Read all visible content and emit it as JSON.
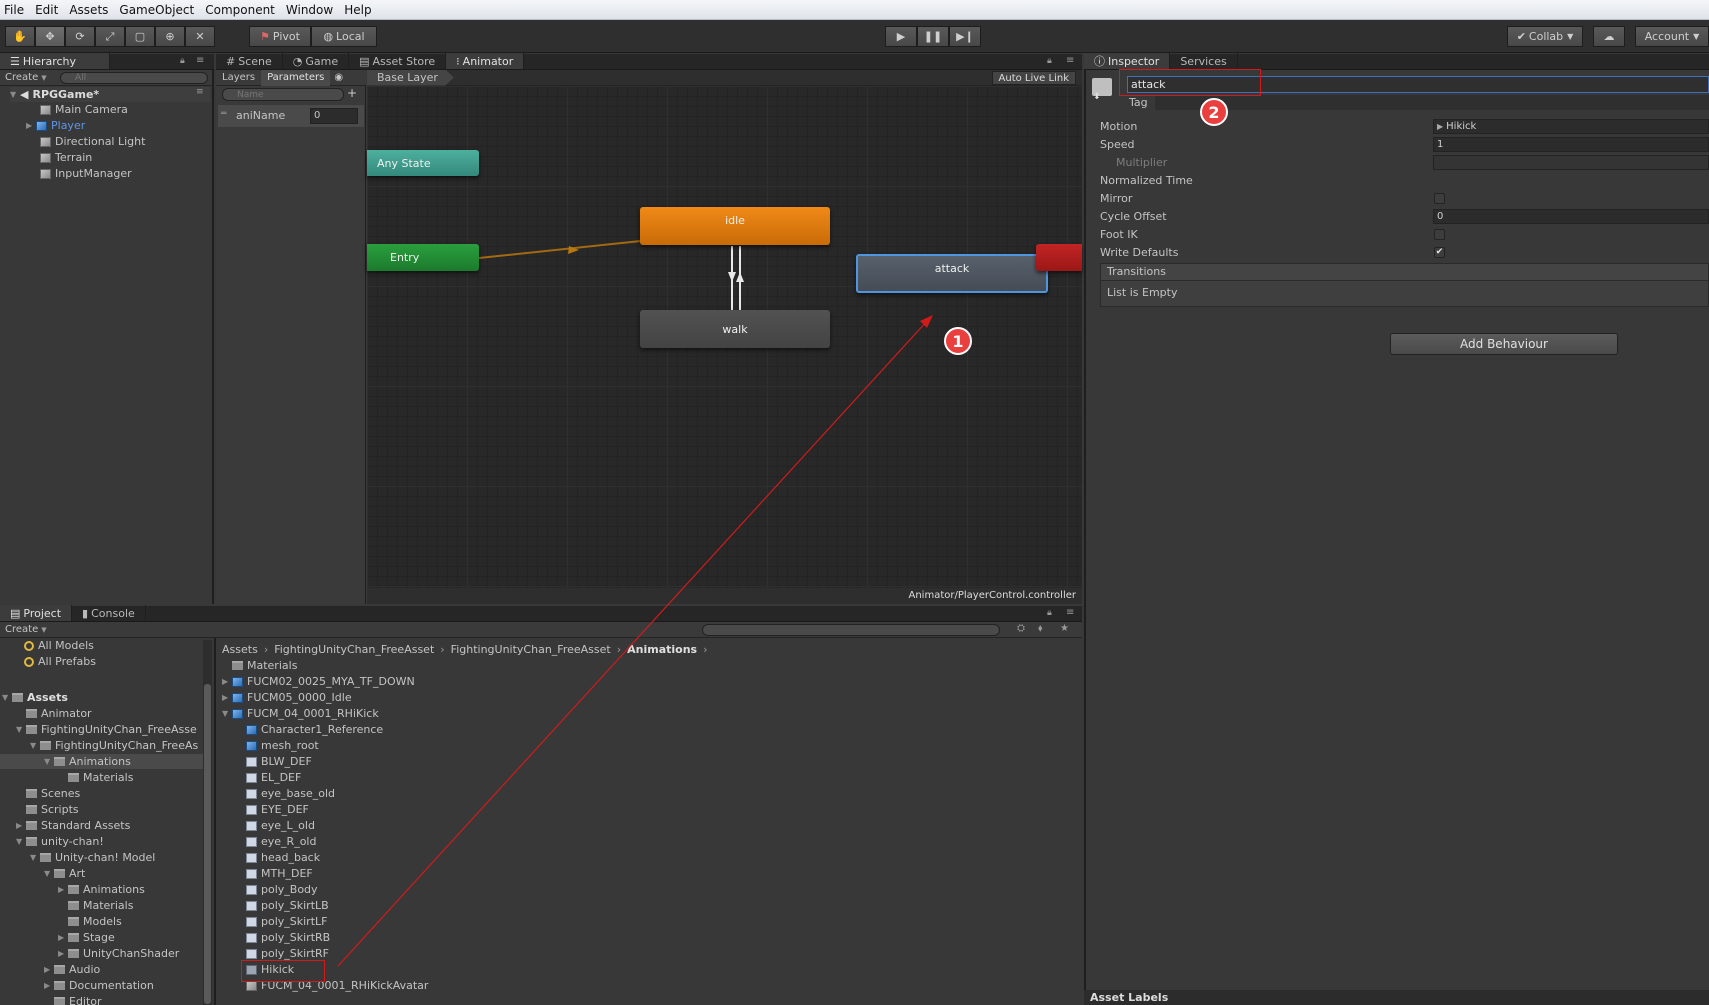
{
  "menubar": {
    "items": [
      "File",
      "Edit",
      "Assets",
      "GameObject",
      "Component",
      "Window",
      "Help"
    ]
  },
  "toolbar": {
    "tool_icons": [
      "hand-icon",
      "move-icon",
      "rotate-icon",
      "scale-icon",
      "rect-icon",
      "transform-icon",
      "custom-icon"
    ],
    "pivot": "Pivot",
    "local": "Local",
    "collab": "Collab",
    "account": "Account"
  },
  "hierarchy": {
    "tab": "Hierarchy",
    "create": "Create",
    "search_placeholder": "All",
    "scene": "RPGGame*",
    "items": [
      "Main Camera",
      "Player",
      "Directional Light",
      "Terrain",
      "InputManager"
    ]
  },
  "center_tabs": [
    "Scene",
    "Game",
    "Asset Store",
    "Animator"
  ],
  "animator": {
    "layers_tab": "Layers",
    "params_tab": "Parameters",
    "name_placeholder": "Name",
    "param_name": "aniName",
    "param_value": "0",
    "breadcrumb": "Base Layer",
    "auto_live_link": "Auto Live Link",
    "footer": "Animator/PlayerControl.controller",
    "states": {
      "any": "Any State",
      "entry": "Entry",
      "idle": "idle",
      "walk": "walk",
      "attack": "attack"
    }
  },
  "inspector": {
    "tabs": [
      "Inspector",
      "Services"
    ],
    "state_name": "attack",
    "tag_label": "Tag",
    "fields": {
      "motion_label": "Motion",
      "motion_value": "Hikick",
      "speed_label": "Speed",
      "speed_value": "1",
      "multiplier_label": "Multiplier",
      "normalized_label": "Normalized Time",
      "mirror_label": "Mirror",
      "cycle_label": "Cycle Offset",
      "cycle_value": "0",
      "footik_label": "Foot IK",
      "write_label": "Write Defaults"
    },
    "transitions": "Transitions",
    "list_empty": "List is Empty",
    "add_behaviour": "Add Behaviour",
    "asset_labels": "Asset Labels"
  },
  "bottom_tabs": [
    "Project",
    "Console"
  ],
  "project": {
    "create": "Create",
    "favorites": [
      "All Models",
      "All Prefabs"
    ],
    "tree": [
      {
        "label": "Assets",
        "depth": 0,
        "arrow": "▼",
        "bold": true
      },
      {
        "label": "Animator",
        "depth": 1,
        "arrow": ""
      },
      {
        "label": "FightingUnityChan_FreeAsse",
        "depth": 1,
        "arrow": "▼"
      },
      {
        "label": "FightingUnityChan_FreeAs",
        "depth": 2,
        "arrow": "▼"
      },
      {
        "label": "Animations",
        "depth": 3,
        "arrow": "▼",
        "selected": true
      },
      {
        "label": "Materials",
        "depth": 4,
        "arrow": ""
      },
      {
        "label": "Scenes",
        "depth": 1,
        "arrow": ""
      },
      {
        "label": "Scripts",
        "depth": 1,
        "arrow": ""
      },
      {
        "label": "Standard Assets",
        "depth": 1,
        "arrow": "▶"
      },
      {
        "label": "unity-chan!",
        "depth": 1,
        "arrow": "▼"
      },
      {
        "label": "Unity-chan! Model",
        "depth": 2,
        "arrow": "▼"
      },
      {
        "label": "Art",
        "depth": 3,
        "arrow": "▼"
      },
      {
        "label": "Animations",
        "depth": 4,
        "arrow": "▶"
      },
      {
        "label": "Materials",
        "depth": 4,
        "arrow": ""
      },
      {
        "label": "Models",
        "depth": 4,
        "arrow": ""
      },
      {
        "label": "Stage",
        "depth": 4,
        "arrow": "▶"
      },
      {
        "label": "UnityChanShader",
        "depth": 4,
        "arrow": "▶"
      },
      {
        "label": "Audio",
        "depth": 3,
        "arrow": "▶"
      },
      {
        "label": "Documentation",
        "depth": 3,
        "arrow": "▶"
      },
      {
        "label": "Editor",
        "depth": 3,
        "arrow": ""
      }
    ],
    "breadcrumb": [
      "Assets",
      "FightingUnityChan_FreeAsset",
      "FightingUnityChan_FreeAsset",
      "Animations"
    ],
    "files": [
      {
        "label": "Materials",
        "depth": 0,
        "arrow": "",
        "icon": "folder"
      },
      {
        "label": "FUCM02_0025_MYA_TF_DOWN",
        "depth": 0,
        "arrow": "▶",
        "icon": "blue"
      },
      {
        "label": "FUCM05_0000_Idle",
        "depth": 0,
        "arrow": "▶",
        "icon": "blue"
      },
      {
        "label": "FUCM_04_0001_RHiKick",
        "depth": 0,
        "arrow": "▼",
        "icon": "blue"
      },
      {
        "label": "Character1_Reference",
        "depth": 1,
        "arrow": "",
        "icon": "blue"
      },
      {
        "label": "mesh_root",
        "depth": 1,
        "arrow": "",
        "icon": "blue"
      },
      {
        "label": "BLW_DEF",
        "depth": 1,
        "arrow": "",
        "icon": "file"
      },
      {
        "label": "EL_DEF",
        "depth": 1,
        "arrow": "",
        "icon": "file"
      },
      {
        "label": "eye_base_old",
        "depth": 1,
        "arrow": "",
        "icon": "file"
      },
      {
        "label": "EYE_DEF",
        "depth": 1,
        "arrow": "",
        "icon": "file"
      },
      {
        "label": "eye_L_old",
        "depth": 1,
        "arrow": "",
        "icon": "file"
      },
      {
        "label": "eye_R_old",
        "depth": 1,
        "arrow": "",
        "icon": "file"
      },
      {
        "label": "head_back",
        "depth": 1,
        "arrow": "",
        "icon": "file"
      },
      {
        "label": "MTH_DEF",
        "depth": 1,
        "arrow": "",
        "icon": "file"
      },
      {
        "label": "poly_Body",
        "depth": 1,
        "arrow": "",
        "icon": "file"
      },
      {
        "label": "poly_SkirtLB",
        "depth": 1,
        "arrow": "",
        "icon": "file"
      },
      {
        "label": "poly_SkirtLF",
        "depth": 1,
        "arrow": "",
        "icon": "file"
      },
      {
        "label": "poly_SkirtRB",
        "depth": 1,
        "arrow": "",
        "icon": "file"
      },
      {
        "label": "poly_SkirtRF",
        "depth": 1,
        "arrow": "",
        "icon": "file"
      },
      {
        "label": "Hikick",
        "depth": 1,
        "arrow": "",
        "icon": "file2"
      },
      {
        "label": "FUCM_04_0001_RHiKickAvatar",
        "depth": 1,
        "arrow": "",
        "icon": "go"
      }
    ]
  },
  "annotations": {
    "badge1": "1",
    "badge2": "2"
  },
  "colors": {
    "idle": "#e07b0e",
    "entry": "#1f8a34",
    "any_state": "#3c9e8d",
    "attack": "#4d5560",
    "walk": "#4a4a4a",
    "annotation": "#ea3f3f"
  }
}
